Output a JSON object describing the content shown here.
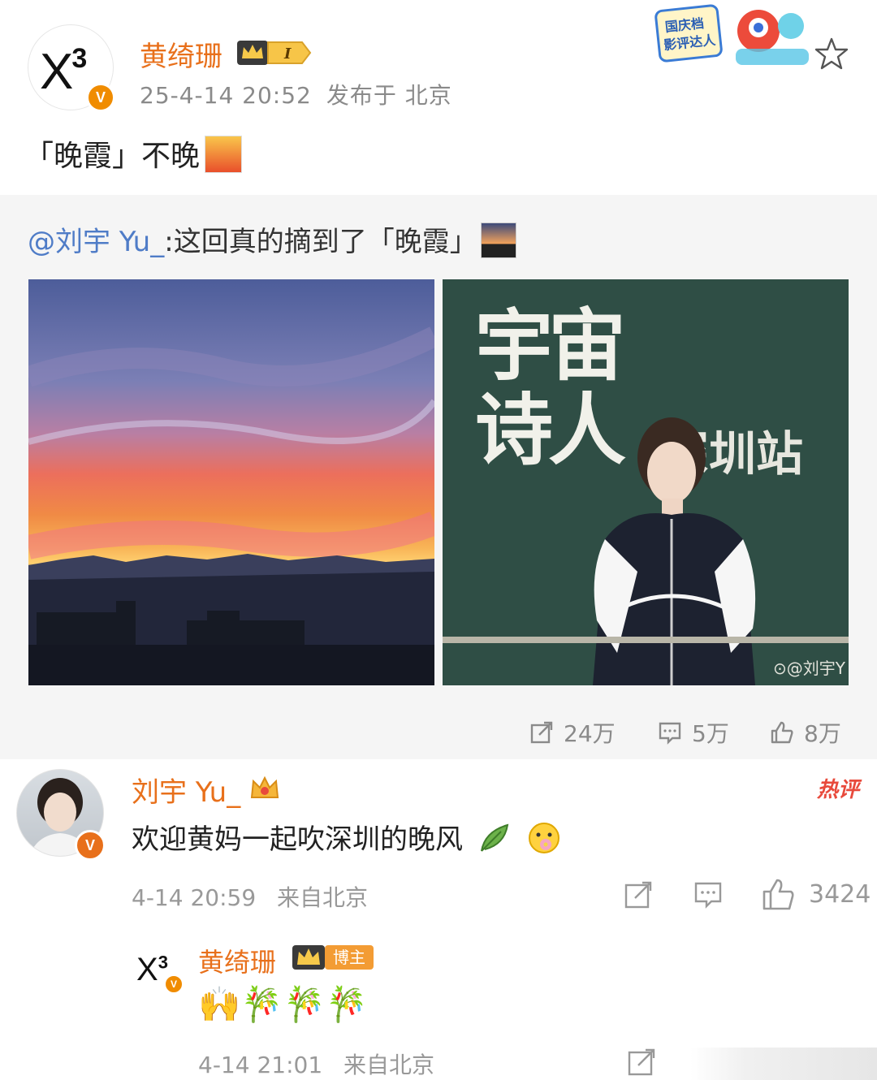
{
  "post": {
    "author": "黄绮珊",
    "level": "I",
    "timestamp": "25-4-14 20:52",
    "location": "发布于 北京",
    "text": "「晚霞」不晚",
    "sticker_text": "国庆档影评达人"
  },
  "repost": {
    "mention": "@刘宇 Yu_",
    "text": ":这回真的摘到了「晚霞」",
    "poster": {
      "title_line1": "宇宙",
      "title_line2": "诗人",
      "subtitle": "深圳站",
      "credit": "⊙@刘宇Y"
    },
    "stats": {
      "reposts": "24万",
      "comments": "5万",
      "likes": "8万"
    }
  },
  "comment": {
    "author": "刘宇 Yu_",
    "hot_label": "热评",
    "text": "欢迎黄妈一起吹深圳的晚风",
    "time": "4-14 20:59",
    "location": "来自北京",
    "likes": "3424"
  },
  "reply": {
    "author": "黄绮珊",
    "badge": "博主",
    "emojis": "🙌🎋🎋🎋",
    "time": "4-14 21:01",
    "location": "来自北京"
  },
  "colors": {
    "name": "#e8701b",
    "mention": "#4f7cc7",
    "hot": "#e84a3c",
    "meta": "#8a8a8a",
    "repost_bg": "#f5f5f5"
  }
}
